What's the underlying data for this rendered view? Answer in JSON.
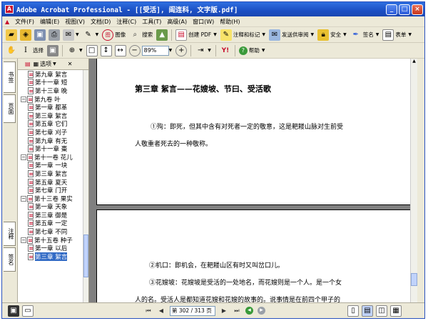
{
  "window": {
    "title": "Adobe Acrobat Professional - [[受活], 阎连科, 文字版.pdf]"
  },
  "menu": [
    "文件(F)",
    "编辑(E)",
    "视图(V)",
    "文档(D)",
    "注释(C)",
    "工具(T)",
    "高级(A)",
    "窗口(W)",
    "帮助(H)"
  ],
  "toolbar1": {
    "search_label": "搜索",
    "create_pdf_label": "创建 PDF",
    "comment_label": "注释和标记",
    "review_label": "发送供审阅",
    "secure_label": "安全",
    "sign_label": "签名",
    "forms_label": "表单"
  },
  "toolbar2": {
    "select_label": "选择",
    "zoom_value": "89%",
    "help_label": "帮助"
  },
  "bookmarks": {
    "options_label": "选项",
    "items": [
      {
        "label": "第九章 絮言",
        "level": 2,
        "toggle": ""
      },
      {
        "label": "第十一章 短",
        "level": 2,
        "toggle": ""
      },
      {
        "label": "第十三章 晚",
        "level": 2,
        "toggle": ""
      },
      {
        "label": "第九卷 叶",
        "level": 1,
        "toggle": "−"
      },
      {
        "label": "第一章 都革",
        "level": 2,
        "toggle": ""
      },
      {
        "label": "第三章 絮言",
        "level": 2,
        "toggle": ""
      },
      {
        "label": "第五章 它们",
        "level": 2,
        "toggle": ""
      },
      {
        "label": "第七章 刈子",
        "level": 2,
        "toggle": ""
      },
      {
        "label": "第九章 有无",
        "level": 2,
        "toggle": ""
      },
      {
        "label": "第十一章 棗",
        "level": 2,
        "toggle": ""
      },
      {
        "label": "第十一卷 花儿",
        "level": 1,
        "toggle": "−"
      },
      {
        "label": "第一章 一块",
        "level": 2,
        "toggle": ""
      },
      {
        "label": "第三章 絮言",
        "level": 2,
        "toggle": ""
      },
      {
        "label": "第五章 夏天",
        "level": 2,
        "toggle": ""
      },
      {
        "label": "第七章 门开",
        "level": 2,
        "toggle": ""
      },
      {
        "label": "第十三卷 果实",
        "level": 1,
        "toggle": "−"
      },
      {
        "label": "第一章 天象",
        "level": 2,
        "toggle": ""
      },
      {
        "label": "第三章 御是",
        "level": 2,
        "toggle": ""
      },
      {
        "label": "第五章 一定",
        "level": 2,
        "toggle": ""
      },
      {
        "label": "第七章 不同",
        "level": 2,
        "toggle": ""
      },
      {
        "label": "第十五卷 种子",
        "level": 1,
        "toggle": "−"
      },
      {
        "label": "第一章 以后",
        "level": 2,
        "toggle": ""
      },
      {
        "label": "第三章 絮言",
        "level": 2,
        "toggle": "",
        "selected": true
      }
    ]
  },
  "navtabs": {
    "bookmarks_tab": "书签",
    "pages_tab": "页面",
    "comments_tab": "注释",
    "signatures_tab": "签名"
  },
  "page1": {
    "title": "第三章  絮言——花嫂坡、节曰、受活歌",
    "para1_line1": "①殉：即死，但其中含有对死者一定的敬意，这是耙耧山脉对生前受",
    "para1_line2": "人敬重者死去的一种敬称。"
  },
  "page2": {
    "line1": "②机口：即机会，在耙耧山区有时又叫岔口儿。",
    "line2": "③花嫂坡：花嫂坡是受活的一处地名，而花嫂则是一个人。是一个女",
    "line3": "人的名。受活人是都知道花嫂和花嫂的故事的。说事情是在前四个甲子的"
  },
  "status": {
    "page_field": "第 302 / 313 页"
  }
}
